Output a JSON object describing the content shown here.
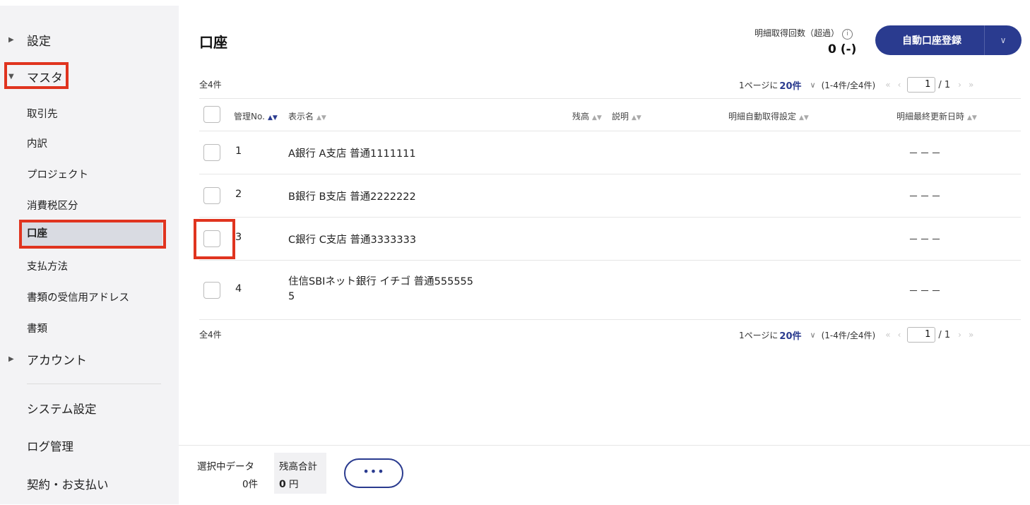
{
  "sidebar": {
    "settings": "設定",
    "master": "マスタ",
    "items": [
      "取引先",
      "内訳",
      "プロジェクト",
      "消費税区分",
      "口座",
      "支払方法",
      "書類の受信用アドレス",
      "書類"
    ],
    "account": "アカウント",
    "system_items": [
      "システム設定",
      "ログ管理",
      "契約・お支払い"
    ]
  },
  "header": {
    "title": "口座",
    "quota_label": "明細取得回数（超過）",
    "quota_info_icon": "ⓘ",
    "quota_value": "0 (-)",
    "primary_button": "自動口座登録",
    "dropdown_icon": "∨"
  },
  "pagination": {
    "total": "全4件",
    "per_page_prefix": "1ページに",
    "per_page_value": "20件",
    "range": "(1-4件/全4件)",
    "current_page": "1",
    "total_pages": "/ 1"
  },
  "table": {
    "columns": {
      "no": "管理No.",
      "name": "表示名",
      "balance": "残高",
      "description": "説明",
      "auto_fetch": "明細自動取得設定",
      "last_updated": "明細最終更新日時"
    },
    "rows": [
      {
        "no": "1",
        "name": "A銀行 A支店 普通1111111",
        "last_updated": "－－－"
      },
      {
        "no": "2",
        "name": "B銀行 B支店 普通2222222",
        "last_updated": "－－－"
      },
      {
        "no": "3",
        "name": "C銀行 C支店 普通3333333",
        "last_updated": "－－－"
      },
      {
        "no": "4",
        "name_line1": "住信SBIネット銀行 イチゴ 普通555555",
        "name_line2": "5",
        "last_updated": "－－－"
      }
    ]
  },
  "footer": {
    "selected_label": "選択中データ",
    "selected_count": "0件",
    "balance_label": "残高合計",
    "balance_value": "0",
    "balance_unit": "円",
    "more_button": "•••"
  },
  "colors": {
    "primary": "#2a3b8f",
    "highlight": "#e0341f",
    "sidebar_bg": "#f3f3f5",
    "active_item_bg": "#d9dbe2"
  }
}
